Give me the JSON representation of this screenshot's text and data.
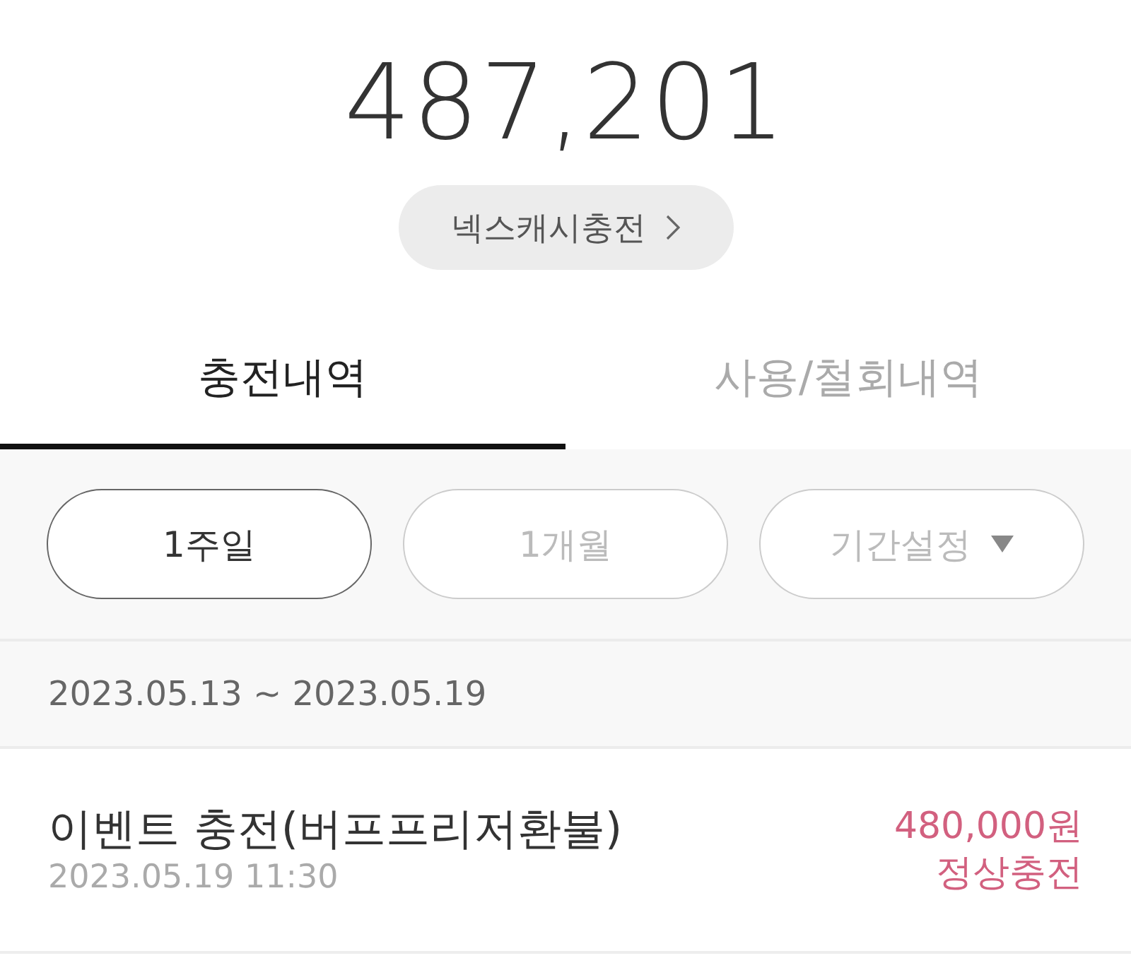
{
  "balance": "487,201",
  "charge_button": {
    "label": "넥스캐시충전"
  },
  "tabs": [
    {
      "label": "충전내역",
      "selected": true
    },
    {
      "label": "사용/철회내역",
      "selected": false
    }
  ],
  "filters": [
    {
      "label": "1주일",
      "selected": true,
      "kind": "preset"
    },
    {
      "label": "1개월",
      "selected": false,
      "kind": "preset"
    },
    {
      "label": "기간설정",
      "selected": false,
      "kind": "dropdown"
    }
  ],
  "date_range": "2023.05.13 ~ 2023.05.19",
  "transactions": [
    {
      "title": "이벤트 충전(버프프리저환불)",
      "datetime": "2023.05.19 11:30",
      "amount": "480,000원",
      "status": "정상충전"
    }
  ]
}
